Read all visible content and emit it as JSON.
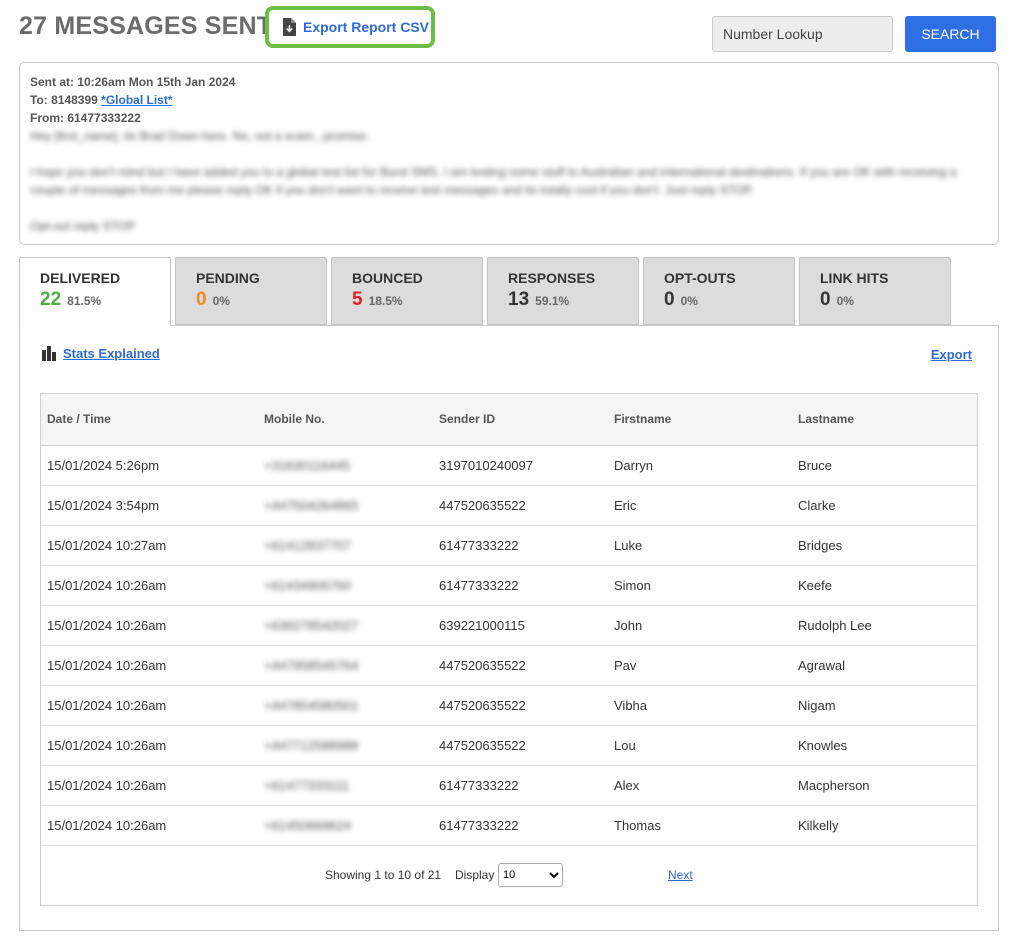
{
  "header": {
    "title": "27 MESSAGES SENT",
    "export_csv_label": "Export Report CSV",
    "lookup_placeholder": "Number Lookup",
    "search_label": "SEARCH"
  },
  "message": {
    "sent_at": "Sent at: 10:26am Mon 15th Jan 2024",
    "to_prefix": "To: 8148399",
    "to_link": "*Global List*",
    "from": "From: 61477333222",
    "body_1": "Hey [first_name], its Brad Down here. No, not a scam...promise.",
    "body_2": "I hope you don't mind but I have added you to a global test list for Burst SMS. I am testing some stuff to Australian and international destinations. If you are OK with receiving a couple of messages from me please reply OK if you don't want to receive test messages and its totally cool if you don't. Just reply STOP.",
    "body_3": "Opt-out reply STOP"
  },
  "tabs": [
    {
      "name": "DELIVERED",
      "count": "22",
      "pct": "81.5%",
      "color": "#4caf3f"
    },
    {
      "name": "PENDING",
      "count": "0",
      "pct": "0%",
      "color": "#f08a1a"
    },
    {
      "name": "BOUNCED",
      "count": "5",
      "pct": "18.5%",
      "color": "#e02020"
    },
    {
      "name": "RESPONSES",
      "count": "13",
      "pct": "59.1%",
      "color": "#333333"
    },
    {
      "name": "OPT-OUTS",
      "count": "0",
      "pct": "0%",
      "color": "#333333"
    },
    {
      "name": "LINK HITS",
      "count": "0",
      "pct": "0%",
      "color": "#333333"
    }
  ],
  "panel": {
    "stats_label": "Stats Explained",
    "export_label": "Export"
  },
  "table": {
    "headers": [
      "Date / Time",
      "Mobile No.",
      "Sender ID",
      "Firstname",
      "Lastname"
    ],
    "rows": [
      [
        "15/01/2024 5:26pm",
        "+31630116445",
        "3197010240097",
        "Darryn",
        "Bruce"
      ],
      [
        "15/01/2024 3:54pm",
        "+447504264865",
        "447520635522",
        "Eric",
        "Clarke"
      ],
      [
        "15/01/2024 10:27am",
        "+61412837707",
        "61477333222",
        "Luke",
        "Bridges"
      ],
      [
        "15/01/2024 10:26am",
        "+61434906760",
        "61477333222",
        "Simon",
        "Keefe"
      ],
      [
        "15/01/2024 10:26am",
        "+639278542027",
        "639221000115",
        "John",
        "Rudolph Lee"
      ],
      [
        "15/01/2024 10:26am",
        "+447958545764",
        "447520635522",
        "Pav",
        "Agrawal"
      ],
      [
        "15/01/2024 10:26am",
        "+447854580501",
        "447520635522",
        "Vibha",
        "Nigam"
      ],
      [
        "15/01/2024 10:26am",
        "+447712588988",
        "447520635522",
        "Lou",
        "Knowles"
      ],
      [
        "15/01/2024 10:26am",
        "+61477333111",
        "61477333222",
        "Alex",
        "Macpherson"
      ],
      [
        "15/01/2024 10:26am",
        "+61450669624",
        "61477333222",
        "Thomas",
        "Kilkelly"
      ]
    ]
  },
  "pager": {
    "showing": "Showing 1 to 10 of 21",
    "display_label": "Display",
    "display_value": "10",
    "next_label": "Next"
  }
}
